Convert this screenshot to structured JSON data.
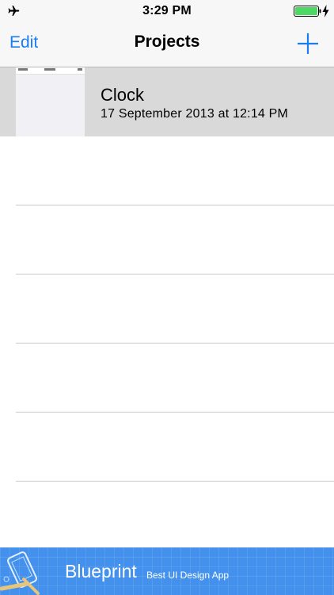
{
  "status_bar": {
    "time": "3:29 PM",
    "left_icon": "airplane-icon",
    "battery_icon": "battery-icon",
    "charging_icon": "charging-icon",
    "battery_level": 1.0,
    "battery_color": "#4cd964"
  },
  "nav": {
    "edit_label": "Edit",
    "title": "Projects",
    "add_icon": "plus-icon",
    "accent_color": "#1b7df2"
  },
  "projects": [
    {
      "name": "Clock",
      "date": "17 September 2013 at 12:14 PM",
      "thumbnail_icon": "project-thumbnail"
    }
  ],
  "banner": {
    "title": "Blueprint",
    "subtitle": "Best UI Design App",
    "logo_icon": "blueprint-logo-icon",
    "background_color": "#4391ec"
  }
}
